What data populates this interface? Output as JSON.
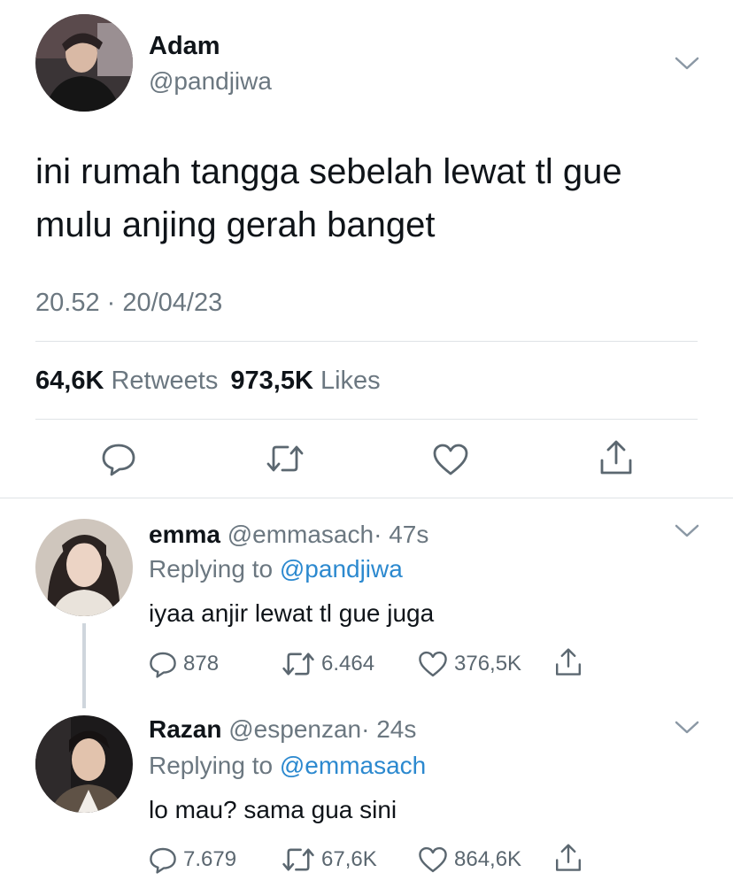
{
  "tweet": {
    "author_name": "Adam",
    "author_handle": "@pandjiwa",
    "text_line1": "ini rumah tangga sebelah lewat tl gue",
    "text_line2": "mulu anjing gerah banget",
    "time": "20.52 · 20/04/23",
    "retweets_count": "64,6K",
    "retweets_label": "Retweets",
    "likes_count": "973,5K",
    "likes_label": "Likes"
  },
  "replies": [
    {
      "name": "emma",
      "handle": "@emmasach",
      "age": "· 47s",
      "replying_prefix": "Replying to",
      "replying_to": "@pandjiwa",
      "text": "iyaa anjir lewat tl gue juga",
      "reply_count": "878",
      "retweet_count": "6.464",
      "like_count": "376,5K"
    },
    {
      "name": "Razan",
      "handle": "@espenzan",
      "age": "· 24s",
      "replying_prefix": "Replying to",
      "replying_to": "@emmasach",
      "text": "lo mau? sama gua sini",
      "reply_count": "7.679",
      "retweet_count": "67,6K",
      "like_count": "864,6K"
    }
  ],
  "icons": [
    "chevron-down-icon",
    "reply-icon",
    "retweet-icon",
    "like-icon",
    "share-icon"
  ],
  "colors": {
    "text": "#0f1419",
    "secondary": "#6b7780",
    "link": "#2c89cf",
    "divider": "#dfe3e6"
  }
}
